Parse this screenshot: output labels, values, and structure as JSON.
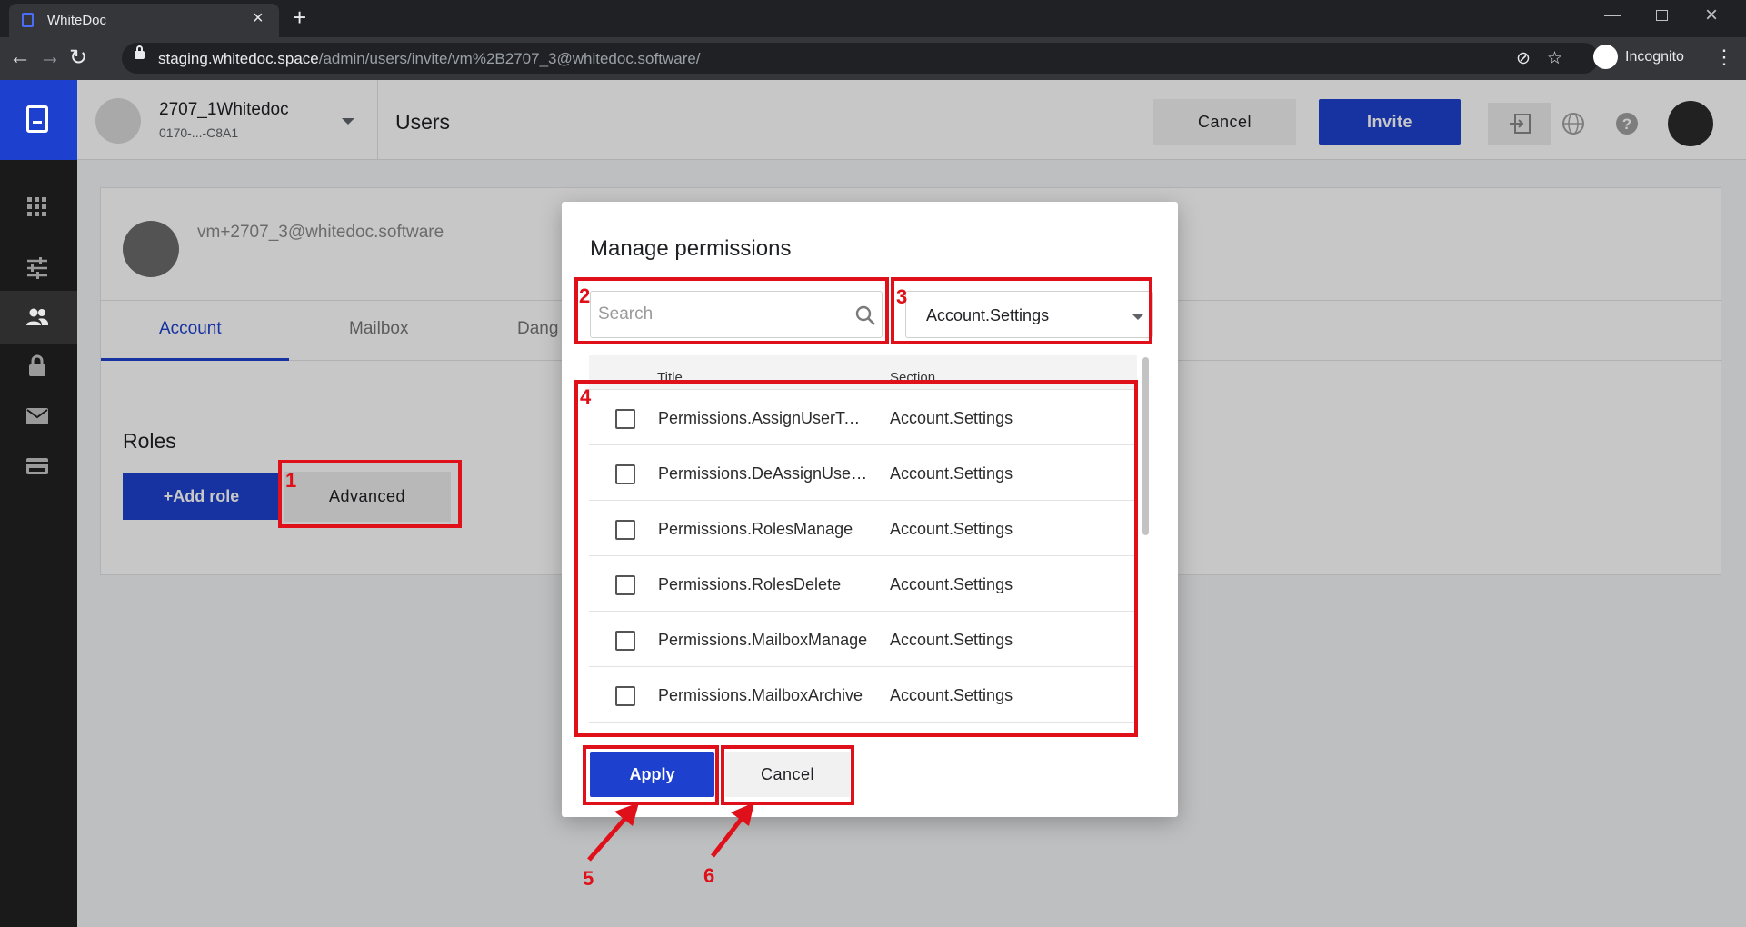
{
  "browser": {
    "tab_title": "WhiteDoc",
    "url_host": "staging.whitedoc.space",
    "url_path": "/admin/users/invite/vm%2B2707_3@whitedoc.software/",
    "profile_label": "Incognito"
  },
  "header": {
    "org_name": "2707_1Whitedoc",
    "org_id": "0170-...-C8A1",
    "page_title": "Users",
    "cancel_label": "Cancel",
    "invite_label": "Invite"
  },
  "sidebar": {
    "icons": [
      "documents-icon",
      "grid-icon",
      "sliders-icon",
      "users-icon",
      "lock-icon",
      "mail-icon",
      "card-icon"
    ],
    "active": "users-icon"
  },
  "user_card": {
    "email": "vm+2707_3@whitedoc.software",
    "tabs": [
      {
        "label": "Account"
      },
      {
        "label": "Mailbox"
      },
      {
        "label": "Dang"
      }
    ],
    "active_tab": "Account",
    "roles_heading": "Roles",
    "add_role_label": "+Add role",
    "advanced_label": "Advanced"
  },
  "modal": {
    "title": "Manage permissions",
    "search_placeholder": "Search",
    "section_filter": "Account.Settings",
    "columns": {
      "title": "Title",
      "section": "Section"
    },
    "rows": [
      {
        "title": "Permissions.AssignUserToA...",
        "section": "Account.Settings",
        "checked": false
      },
      {
        "title": "Permissions.DeAssignUserT...",
        "section": "Account.Settings",
        "checked": false
      },
      {
        "title": "Permissions.RolesManage",
        "section": "Account.Settings",
        "checked": false
      },
      {
        "title": "Permissions.RolesDelete",
        "section": "Account.Settings",
        "checked": false
      },
      {
        "title": "Permissions.MailboxManage",
        "section": "Account.Settings",
        "checked": false
      },
      {
        "title": "Permissions.MailboxArchive",
        "section": "Account.Settings",
        "checked": false
      }
    ],
    "apply_label": "Apply",
    "cancel_label": "Cancel"
  },
  "annotations": [
    "1",
    "2",
    "3",
    "4",
    "5",
    "6"
  ],
  "colors": {
    "brand_blue": "#1e40cf",
    "annotation_red": "#e0101a",
    "sidebar_dark": "#1a1a1a"
  }
}
